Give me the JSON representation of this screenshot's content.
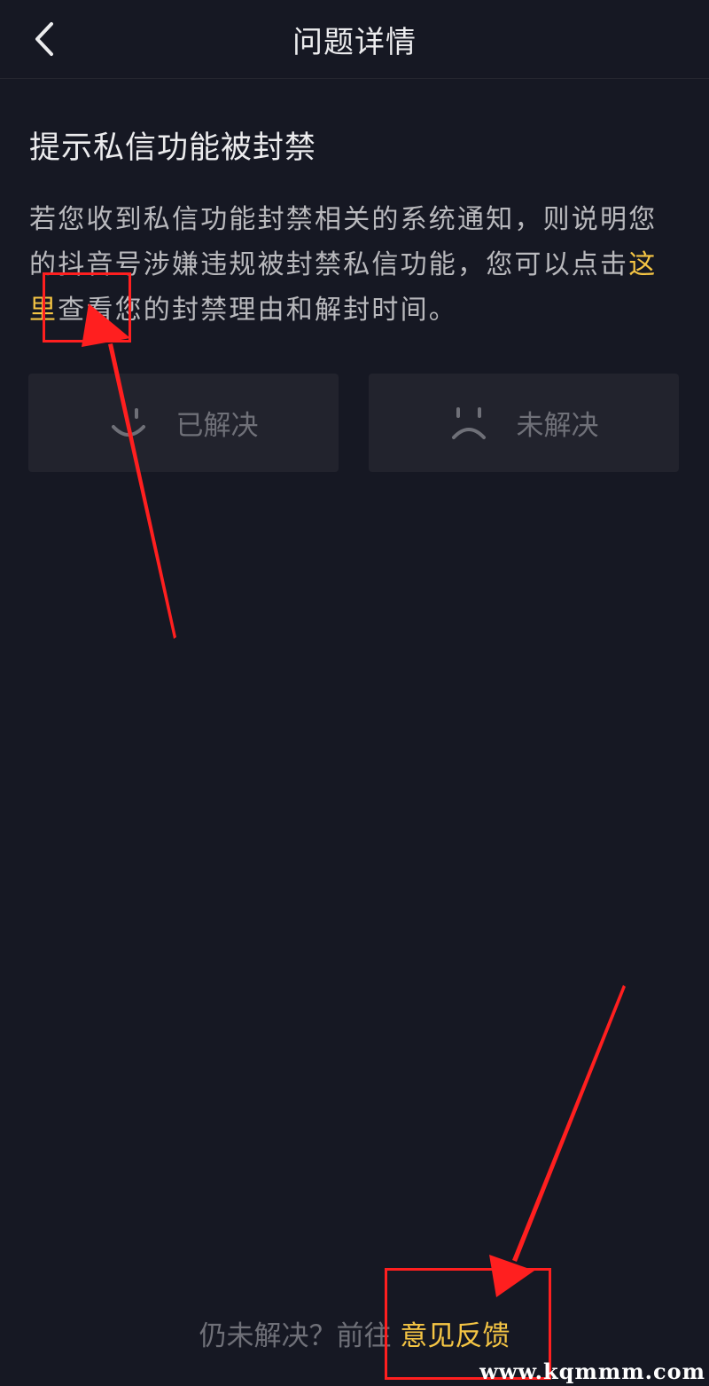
{
  "header": {
    "title": "问题详情",
    "back_icon": "chevron-left-icon"
  },
  "question": {
    "title": "提示私信功能被封禁",
    "body_before": "若您收到私信功能封禁相关的系统通知，则说明您的抖音号涉嫌违规被封禁私信功能，您可以点击",
    "link_text": "这里",
    "body_after": "查看您的封禁理由和解封时间。"
  },
  "feedback": {
    "resolved_label": "已解决",
    "resolved_icon": "smile-icon",
    "unresolved_label": "未解决",
    "unresolved_icon": "frown-icon"
  },
  "footer": {
    "prefix": "仍未解决？前往",
    "link_text": "意见反馈"
  },
  "watermark": "www.kqmmm.com",
  "colors": {
    "background": "#161823",
    "accent": "#f5c544",
    "annotation": "#ff1f1f"
  }
}
